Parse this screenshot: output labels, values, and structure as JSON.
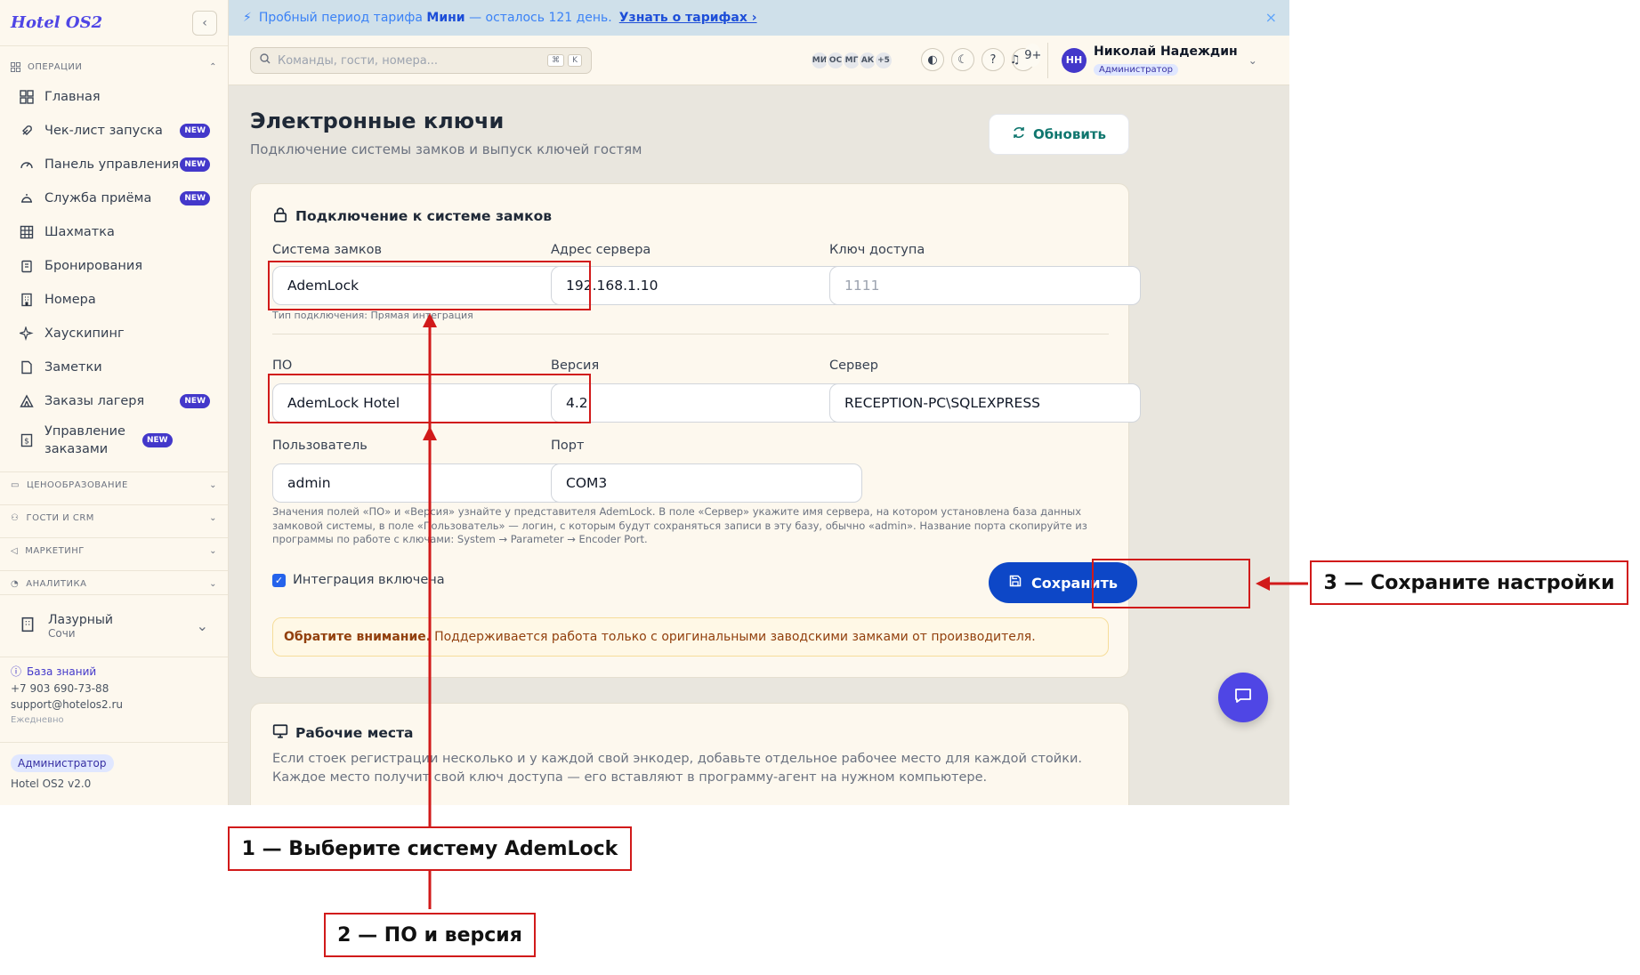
{
  "app": {
    "logo": "Hotel OS2",
    "version": "Hotel OS2 v2.0"
  },
  "sidebar": {
    "operations": "ОПЕРАЦИИ",
    "items": [
      {
        "label": "Главная",
        "badge": ""
      },
      {
        "label": "Чек-лист запуска",
        "badge": "NEW"
      },
      {
        "label": "Панель управления",
        "badge": "NEW"
      },
      {
        "label": "Служба приёма",
        "badge": "NEW"
      },
      {
        "label": "Шахматка",
        "badge": ""
      },
      {
        "label": "Бронирования",
        "badge": ""
      },
      {
        "label": "Номера",
        "badge": ""
      },
      {
        "label": "Хаускипинг",
        "badge": ""
      },
      {
        "label": "Заметки",
        "badge": ""
      },
      {
        "label": "Заказы лагеря",
        "badge": "NEW"
      },
      {
        "label": "Управление заказами",
        "badge": "NEW"
      }
    ],
    "sections": [
      "ЦЕНООБРАЗОВАНИЕ",
      "ГОСТИ И CRM",
      "МАРКЕТИНГ",
      "АНАЛИТИКА"
    ],
    "hotel": {
      "name": "Лазурный",
      "city": "Сочи"
    },
    "support": {
      "kb": "База знаний",
      "phone": "+7 903 690-73-88",
      "email": "support@hotelos2.ru",
      "hours": "Ежедневно"
    },
    "role": "Администратор"
  },
  "trial": {
    "text_before": "Пробный период тарифа",
    "plan": "Мини",
    "text_after": "— осталось 121 день.",
    "link": "Узнать о тарифах ›",
    "close": "×"
  },
  "topbar": {
    "search_placeholder": "Команды, гости, номера...",
    "kbd1": "⌘",
    "kbd2": "K",
    "avatars": [
      "МИ",
      "ОС",
      "МГ",
      "АК",
      "+5"
    ],
    "notif_count": "9+",
    "user": {
      "initials": "НН",
      "name": "Николай Надеждин",
      "role": "Администратор"
    }
  },
  "page": {
    "title": "Электронные ключи",
    "subtitle": "Подключение системы замков и выпуск ключей гостям",
    "refresh": "Обновить"
  },
  "lock_card": {
    "title": "Подключение к системе замков",
    "lock_system": {
      "label": "Система замков",
      "value": "AdemLock",
      "hint": "Тип подключения: Прямая интеграция"
    },
    "server_address": {
      "label": "Адрес сервера",
      "value": "192.168.1.10"
    },
    "access_key": {
      "label": "Ключ доступа",
      "placeholder": "1111"
    },
    "software": {
      "label": "ПО",
      "value": "AdemLock Hotel"
    },
    "version": {
      "label": "Версия",
      "value": "4.2"
    },
    "server": {
      "label": "Сервер",
      "value": "RECEPTION-PC\\SQLEXPRESS"
    },
    "user": {
      "label": "Пользователь",
      "value": "admin"
    },
    "port": {
      "label": "Порт",
      "value": "COM3"
    },
    "note": "Значения полей «ПО» и «Версия» узнайте у представителя AdemLock. В поле «Сервер» укажите имя сервера, на котором установлена база данных замковой системы, в поле «Пользователь» — логин, с которым будут сохраняться записи в эту базу, обычно «admin». Название порта скопируйте из программы по работе с ключами: System → Parameter → Encoder Port.",
    "integration": "Интеграция включена",
    "save": "Сохранить",
    "warning_bold": "Обратите внимание.",
    "warning_text": "Поддерживается работа только с оригинальными заводскими замками от производителя."
  },
  "workplaces": {
    "title": "Рабочие места",
    "desc": "Если стоек регистрации несколько и у каждой свой энкодер, добавьте отдельное рабочее место для каждой стойки. Каждое место получит свой ключ доступа — его вставляют в программу-агент на нужном компьютере."
  },
  "annotations": {
    "step1": "1 — Выберите систему AdemLock",
    "step2": "2 — ПО и версия",
    "step3": "3 — Сохраните настройки",
    "color": "#d11a1a"
  }
}
